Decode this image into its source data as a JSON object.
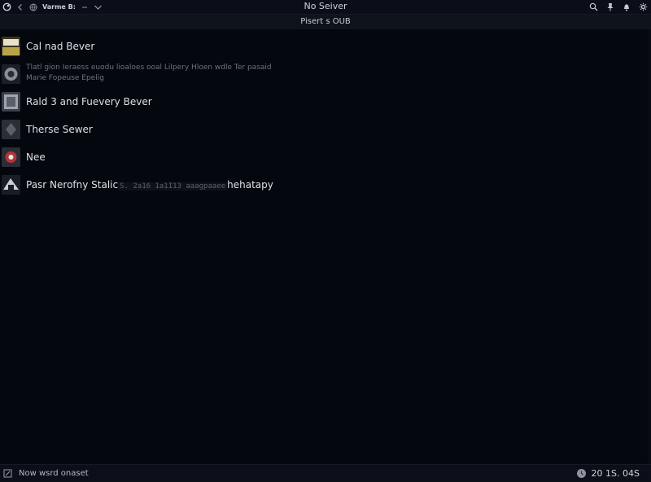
{
  "topbar": {
    "menu_label": "Varme B:",
    "title": "No Seiver",
    "icons": [
      "app-logo-icon",
      "back-icon",
      "globe-icon",
      "chevron-down-icon",
      "search-icon",
      "pin-icon",
      "bell-icon",
      "settings-icon"
    ]
  },
  "subheader": {
    "title": "Pisert s OUB"
  },
  "list": {
    "items": [
      {
        "label": "Cal nad Bever",
        "icon": "server-thumb-icon",
        "thumb_color": "#b9a34a"
      },
      {
        "label": "Tlatl gion Ieraess euodu lioaloes ooal Lilpery Hloen wdle Ter pasaid",
        "sublabel": "Marie Fopeuse Epelig",
        "icon": "server-thumb-icon",
        "thumb_color": "#8a8f98"
      },
      {
        "label": "Rald 3 and Fuevery Bever",
        "icon": "server-thumb-icon",
        "thumb_color": "#9ea4ad"
      },
      {
        "label": "Therse Sewer",
        "icon": "server-thumb-icon",
        "thumb_color": "#5a5f68"
      },
      {
        "label": "Nee",
        "icon": "server-thumb-icon",
        "thumb_color": "#b03538"
      },
      {
        "label": "Pasr Nerofny Stalic",
        "inline_code": "S. 2a16 1a1I13  aaagpaaee",
        "label_suffix": "hehatapy",
        "icon": "server-thumb-icon",
        "thumb_color": "#c9cdd4"
      }
    ]
  },
  "status": {
    "left_label": "Now wsrd onaset",
    "right_label": "20 1S. 04S"
  }
}
